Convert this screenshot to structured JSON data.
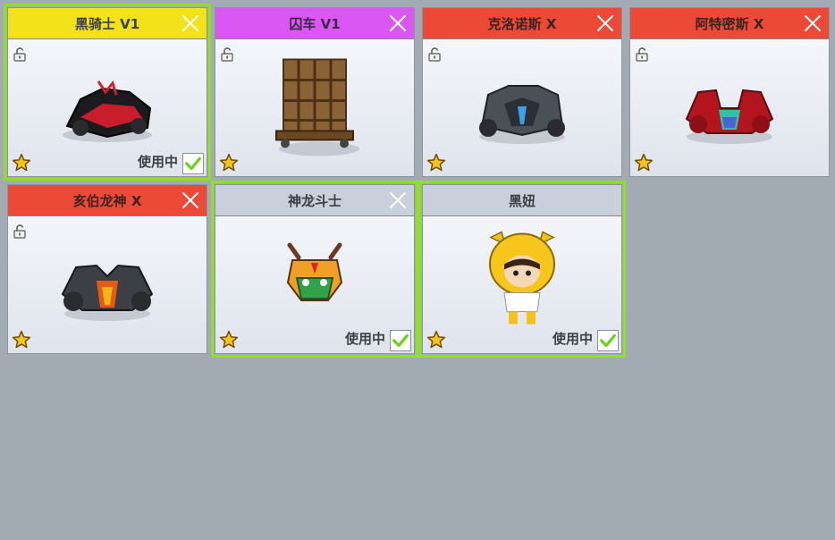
{
  "cards": [
    {
      "title": "黑骑士 V1",
      "header_color": "#f3e21a",
      "in_use": true,
      "use_label": "使用中",
      "closable": true,
      "locked": true,
      "icon": "black-knight-kart"
    },
    {
      "title": "囚车 V1",
      "header_color": "#db57f3",
      "in_use": false,
      "closable": true,
      "locked": true,
      "icon": "wooden-cage-cart"
    },
    {
      "title": "克洛诺斯 X",
      "header_color": "#ec4a37",
      "in_use": false,
      "closable": true,
      "locked": true,
      "icon": "kronos-kart"
    },
    {
      "title": "阿特密斯 X",
      "header_color": "#ec4a37",
      "in_use": false,
      "closable": true,
      "locked": true,
      "icon": "artemis-kart"
    },
    {
      "title": "亥伯龙神 X",
      "header_color": "#ec4a37",
      "in_use": false,
      "closable": true,
      "locked": true,
      "icon": "hyperion-kart"
    },
    {
      "title": "神龙斗士",
      "header_color": "#c9d0db",
      "in_use": true,
      "use_label": "使用中",
      "closable": true,
      "locked": false,
      "icon": "dragon-warrior-mask"
    },
    {
      "title": "黑妞",
      "header_color": "#c9d0db",
      "in_use": true,
      "use_label": "使用中",
      "closable": false,
      "locked": false,
      "icon": "yellow-hood-character"
    }
  ]
}
